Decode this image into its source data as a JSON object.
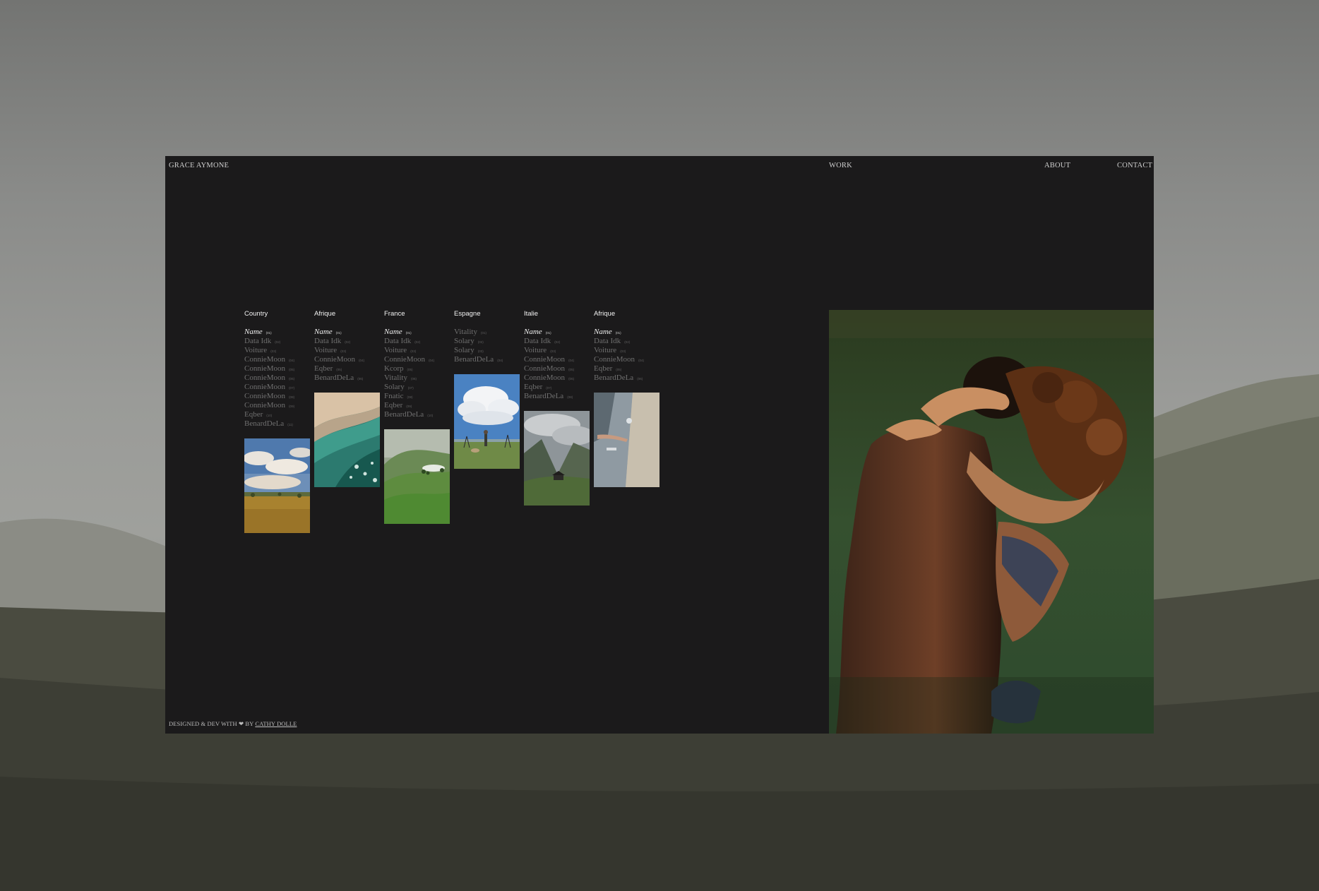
{
  "nav": {
    "brand": "GRACE AYMONE",
    "work": "WORK",
    "about": "ABOUT",
    "contact": "CONTACT"
  },
  "footer": {
    "prefix": "DESIGNED & DEV WITH ❤ BY",
    "author": "CATHY DOLLE"
  },
  "columns": [
    {
      "heading": "Country",
      "items": [
        {
          "label": "Name",
          "num": "(01)"
        },
        {
          "label": "Data Idk",
          "num": "(02)"
        },
        {
          "label": "Voiture",
          "num": "(03)"
        },
        {
          "label": "ConnieMoon",
          "num": "(04)"
        },
        {
          "label": "ConnieMoon",
          "num": "(05)"
        },
        {
          "label": "ConnieMoon",
          "num": "(06)"
        },
        {
          "label": "ConnieMoon",
          "num": "(07)"
        },
        {
          "label": "ConnieMoon",
          "num": "(08)"
        },
        {
          "label": "ConnieMoon",
          "num": "(09)"
        },
        {
          "label": "Eqber",
          "num": "(10)"
        },
        {
          "label": "BenardDeLa",
          "num": "(11)"
        }
      ]
    },
    {
      "heading": "Afrique",
      "items": [
        {
          "label": "Name",
          "num": "(01)"
        },
        {
          "label": "Data Idk",
          "num": "(02)"
        },
        {
          "label": "Voiture",
          "num": "(03)"
        },
        {
          "label": "ConnieMoon",
          "num": "(04)"
        },
        {
          "label": "Eqber",
          "num": "(05)"
        },
        {
          "label": "BenardDeLa",
          "num": "(06)"
        }
      ]
    },
    {
      "heading": "France",
      "items": [
        {
          "label": "Name",
          "num": "(01)"
        },
        {
          "label": "Data Idk",
          "num": "(02)"
        },
        {
          "label": "Voiture",
          "num": "(03)"
        },
        {
          "label": "ConnieMoon",
          "num": "(04)"
        },
        {
          "label": "Kcorp",
          "num": "(05)"
        },
        {
          "label": "Vitality",
          "num": "(06)"
        },
        {
          "label": "Solary",
          "num": "(07)"
        },
        {
          "label": "Fnatic",
          "num": "(08)"
        },
        {
          "label": "Eqber",
          "num": "(09)"
        },
        {
          "label": "BenardDeLa",
          "num": "(10)"
        }
      ]
    },
    {
      "heading": "Espagne",
      "items": [
        {
          "label": "Vitality",
          "num": "(01)"
        },
        {
          "label": "Solary",
          "num": "(02)"
        },
        {
          "label": "Solary",
          "num": "(03)"
        },
        {
          "label": "BenardDeLa",
          "num": "(04)"
        }
      ]
    },
    {
      "heading": "Italie",
      "items": [
        {
          "label": "Name",
          "num": "(01)"
        },
        {
          "label": "Data Idk",
          "num": "(02)"
        },
        {
          "label": "Voiture",
          "num": "(03)"
        },
        {
          "label": "ConnieMoon",
          "num": "(04)"
        },
        {
          "label": "ConnieMoon",
          "num": "(05)"
        },
        {
          "label": "ConnieMoon",
          "num": "(06)"
        },
        {
          "label": "Eqber",
          "num": "(07)"
        },
        {
          "label": "BenardDeLa",
          "num": "(08)"
        }
      ]
    },
    {
      "heading": "Afrique",
      "items": [
        {
          "label": "Name",
          "num": "(01)"
        },
        {
          "label": "Data Idk",
          "num": "(02)"
        },
        {
          "label": "Voiture",
          "num": "(03)"
        },
        {
          "label": "ConnieMoon",
          "num": "(04)"
        },
        {
          "label": "Eqber",
          "num": "(05)"
        },
        {
          "label": "BenardDeLa",
          "num": "(06)"
        }
      ]
    }
  ],
  "colors": {
    "window_bg": "#1b1a1b",
    "text_active": "#f0f0f0",
    "text_muted": "#6f6f6f"
  }
}
